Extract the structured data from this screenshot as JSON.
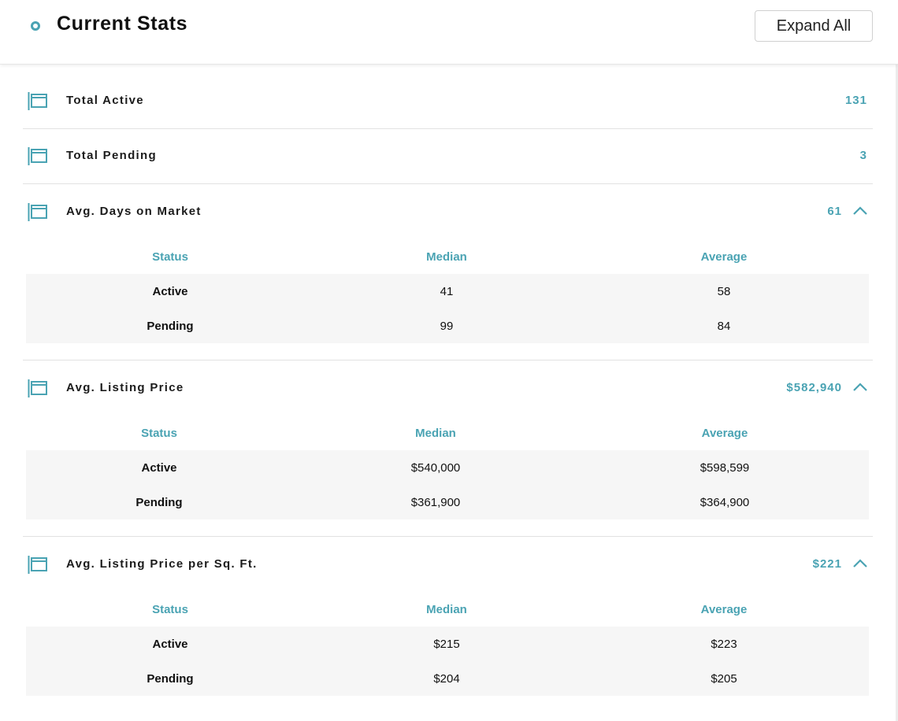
{
  "header": {
    "title": "Current Stats",
    "expand_all_label": "Expand All"
  },
  "colors": {
    "accent": "#4aa3b3",
    "table_bg": "#f6f6f6"
  },
  "icons": {
    "stat_icon": "window-frame-icon",
    "collapse_icon": "chevron-up-icon",
    "header_icon": "circle-dot-icon"
  },
  "stats": [
    {
      "label": "Total Active",
      "value": "131",
      "expanded": false
    },
    {
      "label": "Total Pending",
      "value": "3",
      "expanded": false
    },
    {
      "label": "Avg. Days on Market",
      "value": "61",
      "expanded": true,
      "table": {
        "columns": [
          "Status",
          "Median",
          "Average"
        ],
        "rows": [
          [
            "Active",
            "41",
            "58"
          ],
          [
            "Pending",
            "99",
            "84"
          ]
        ]
      }
    },
    {
      "label": "Avg. Listing Price",
      "value": "$582,940",
      "expanded": true,
      "table": {
        "columns": [
          "Status",
          "Median",
          "Average"
        ],
        "rows": [
          [
            "Active",
            "$540,000",
            "$598,599"
          ],
          [
            "Pending",
            "$361,900",
            "$364,900"
          ]
        ]
      }
    },
    {
      "label": "Avg. Listing Price per Sq. Ft.",
      "value": "$221",
      "expanded": true,
      "table": {
        "columns": [
          "Status",
          "Median",
          "Average"
        ],
        "rows": [
          [
            "Active",
            "$215",
            "$223"
          ],
          [
            "Pending",
            "$204",
            "$205"
          ]
        ]
      }
    }
  ]
}
